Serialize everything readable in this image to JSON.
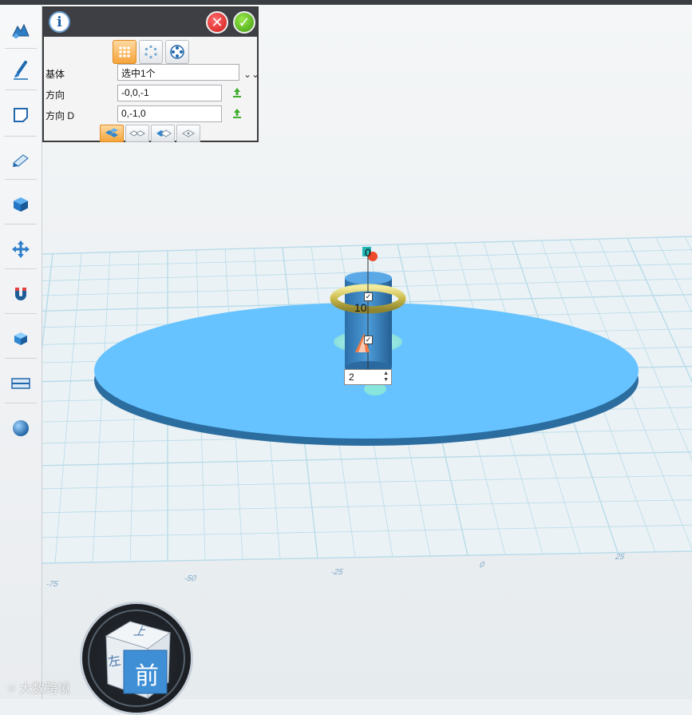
{
  "toolbar": {
    "tools": [
      {
        "icon": "sketch-tool-icon"
      },
      {
        "icon": "brush-tool-icon"
      },
      {
        "icon": "rectangle-tool-icon"
      },
      {
        "icon": "edit-tool-icon"
      },
      {
        "icon": "cube-primitive-icon"
      },
      {
        "icon": "move-tool-icon"
      },
      {
        "icon": "magnet-icon"
      },
      {
        "icon": "combine-icon"
      },
      {
        "icon": "measure-icon"
      },
      {
        "icon": "material-sphere-icon"
      }
    ]
  },
  "panel": {
    "info_icon": "i",
    "fields": {
      "base_label": "基体",
      "base_value": "选中1个",
      "direction_label": "方向",
      "direction_value": "-0,0,-1",
      "direction_d_label": "方向  D",
      "direction_d_value": "0,-1,0"
    },
    "colors": {
      "header_bg": "#3d3f44",
      "active_tab": "#f5a43a"
    }
  },
  "scene": {
    "height_label": "10",
    "top_label": "0",
    "count_value": "2",
    "axis_ticks": [
      "-75",
      "-50",
      "-25",
      "0",
      "25"
    ],
    "disc_color": "#66c3ff",
    "cylinder_color": "#3e84bd",
    "torus_color": "#d6c75a"
  },
  "viewcube": {
    "front_label": "前",
    "top_label": "上",
    "left_label": "左"
  },
  "watermark": {
    "text": "大数跨境"
  }
}
